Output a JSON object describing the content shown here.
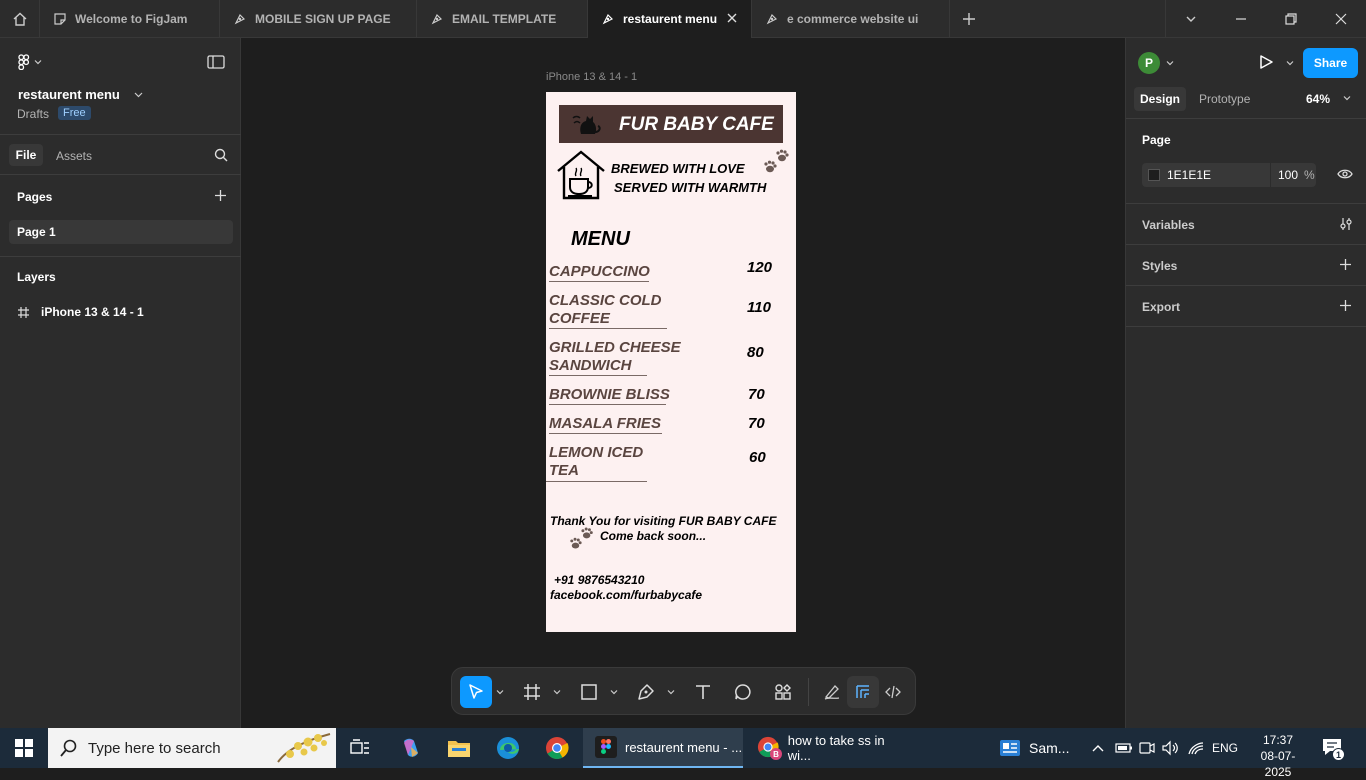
{
  "tabs": [
    {
      "label": "Welcome to FigJam"
    },
    {
      "label": "MOBILE SIGN UP PAGE"
    },
    {
      "label": "EMAIL TEMPLATE"
    },
    {
      "label": "restaurent menu"
    },
    {
      "label": "e commerce website ui"
    }
  ],
  "left_panel": {
    "file_name": "restaurent menu",
    "drafts": "Drafts",
    "plan_badge": "Free",
    "tab_file": "File",
    "tab_assets": "Assets",
    "pages_title": "Pages",
    "page_1": "Page 1",
    "layers_title": "Layers",
    "layer_1": "iPhone 13 & 14 - 1"
  },
  "canvas": {
    "frame_label": "iPhone 13 & 14 - 1",
    "banner": "FUR BABY CAFE",
    "tagline_1": "BREWED WITH LOVE",
    "tagline_2": "SERVED WITH WARMTH",
    "menu_title": "MENU",
    "items": [
      {
        "name": "CAPPUCCINO",
        "price": "120"
      },
      {
        "name_1": "CLASSIC COLD",
        "name_2": "COFFEE",
        "price": "110"
      },
      {
        "name_1": "GRILLED CHEESE",
        "name_2": "SANDWICH",
        "price": "80"
      },
      {
        "name": "BROWNIE BLISS",
        "price": "70"
      },
      {
        "name": "MASALA FRIES",
        "price": "70"
      },
      {
        "name_1": "LEMON ICED",
        "name_2": "TEA",
        "price": "60"
      }
    ],
    "thanks_1": "Thank You for visiting FUR BABY CAFE",
    "thanks_2": "Come back soon...",
    "phone": "+91 9876543210",
    "facebook": "facebook.com/furbabycafe"
  },
  "right_panel": {
    "avatar_letter": "P",
    "share": "Share",
    "tab_design": "Design",
    "tab_prototype": "Prototype",
    "zoom": "64%",
    "page_title": "Page",
    "page_color": "1E1E1E",
    "page_opacity": "100",
    "percent": "%",
    "variables": "Variables",
    "styles": "Styles",
    "export": "Export"
  },
  "toolbar": {
    "help": "?"
  },
  "taskbar": {
    "search_placeholder": "Type here to search",
    "app_figma": "restaurent menu - ...",
    "app_chrome": "how to take ss in wi...",
    "weather_label": "Sam...",
    "lang": "ENG",
    "time": "17:37",
    "date": "08-07-2025",
    "chrome_badge": "B",
    "notif_count": "1"
  },
  "colors": {
    "accent": "#0d99ff",
    "banner": "#4b3532",
    "frame_bg": "#fdf1f1",
    "item_text": "#5a4540"
  }
}
